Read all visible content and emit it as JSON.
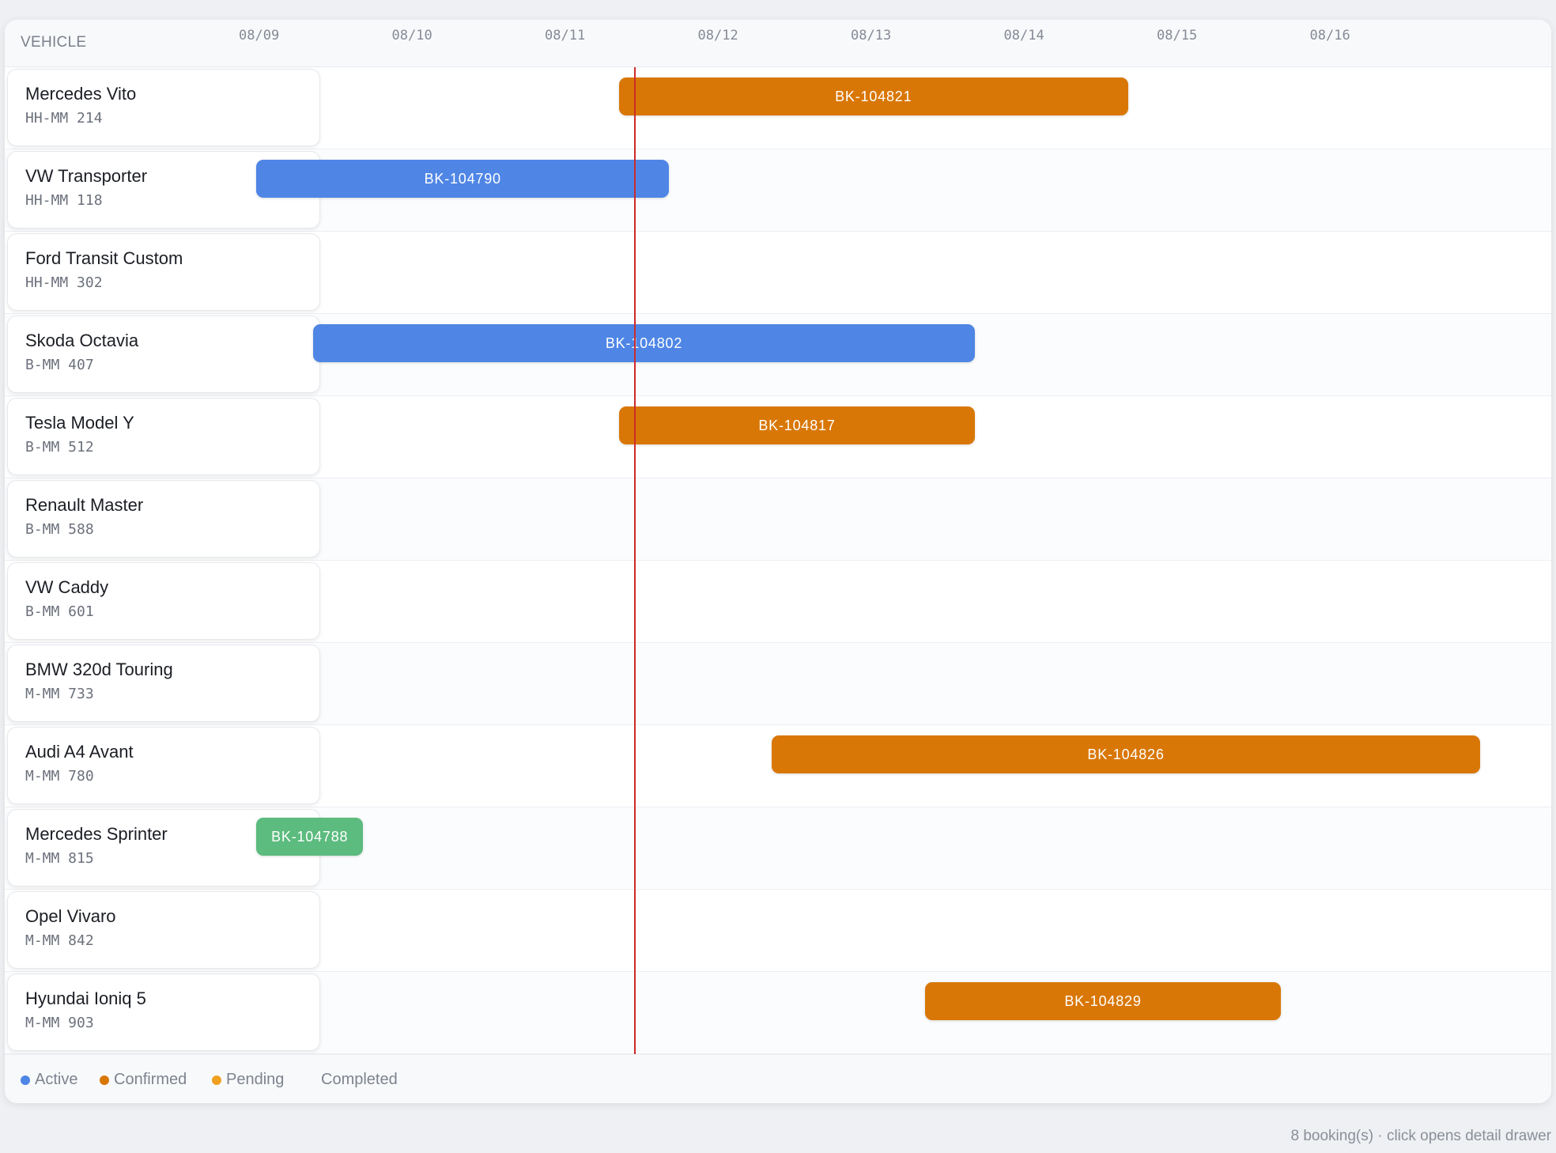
{
  "header": {
    "vehicle_col_label": "VEHICLE",
    "dates": [
      "08/09",
      "08/10",
      "08/11",
      "08/12",
      "08/13",
      "08/14",
      "08/15",
      "08/16"
    ]
  },
  "vehicles": [
    {
      "name": "Mercedes Vito",
      "plate": "HH-MM 214"
    },
    {
      "name": "VW Transporter",
      "plate": "HH-MM 118"
    },
    {
      "name": "Ford Transit Custom",
      "plate": "HH-MM 302"
    },
    {
      "name": "Skoda Octavia",
      "plate": "B-MM 407"
    },
    {
      "name": "Tesla Model Y",
      "plate": "B-MM 512"
    },
    {
      "name": "Renault Master",
      "plate": "B-MM 588"
    },
    {
      "name": "VW Caddy",
      "plate": "B-MM 601"
    },
    {
      "name": "BMW 320d Touring",
      "plate": "M-MM 733"
    },
    {
      "name": "Audi A4 Avant",
      "plate": "M-MM 780"
    },
    {
      "name": "Mercedes Sprinter",
      "plate": "M-MM 815"
    },
    {
      "name": "Opel Vivaro",
      "plate": "M-MM 842"
    },
    {
      "name": "Hyundai Ioniq 5",
      "plate": "M-MM 903"
    }
  ],
  "bookings": [
    {
      "id": "BK-104821",
      "row": 0,
      "start_day": 2.37,
      "end_day": 5.7,
      "status": "Confirmed"
    },
    {
      "id": "BK-104790",
      "row": 1,
      "start_day": 0.0,
      "end_day": 2.7,
      "status": "Active"
    },
    {
      "id": "BK-104802",
      "row": 3,
      "start_day": 0.37,
      "end_day": 4.7,
      "status": "Active"
    },
    {
      "id": "BK-104817",
      "row": 4,
      "start_day": 2.37,
      "end_day": 4.7,
      "status": "Confirmed"
    },
    {
      "id": "BK-104826",
      "row": 8,
      "start_day": 3.37,
      "end_day": 8.0,
      "status": "Confirmed"
    },
    {
      "id": "BK-104788",
      "row": 9,
      "start_day": 0.0,
      "end_day": 0.7,
      "status": "Completed"
    },
    {
      "id": "BK-104829",
      "row": 11,
      "start_day": 4.37,
      "end_day": 6.7,
      "status": "Confirmed"
    }
  ],
  "today_marker_day": 2.47,
  "status_colors": {
    "Active": "#4f86e6",
    "Confirmed": "#d97706",
    "Pending": "#f0a020",
    "Completed": "#5cbb7e"
  },
  "legend": [
    {
      "label": "Active",
      "color": "#4f86e6",
      "dot": true
    },
    {
      "label": "Confirmed",
      "color": "#d97706",
      "dot": true
    },
    {
      "label": "Pending",
      "color": "#f0a020",
      "dot": true
    },
    {
      "label": "Completed",
      "color": "#5cbb7e",
      "dot": false
    }
  ],
  "footer_note": "8 booking(s) · click opens detail drawer"
}
